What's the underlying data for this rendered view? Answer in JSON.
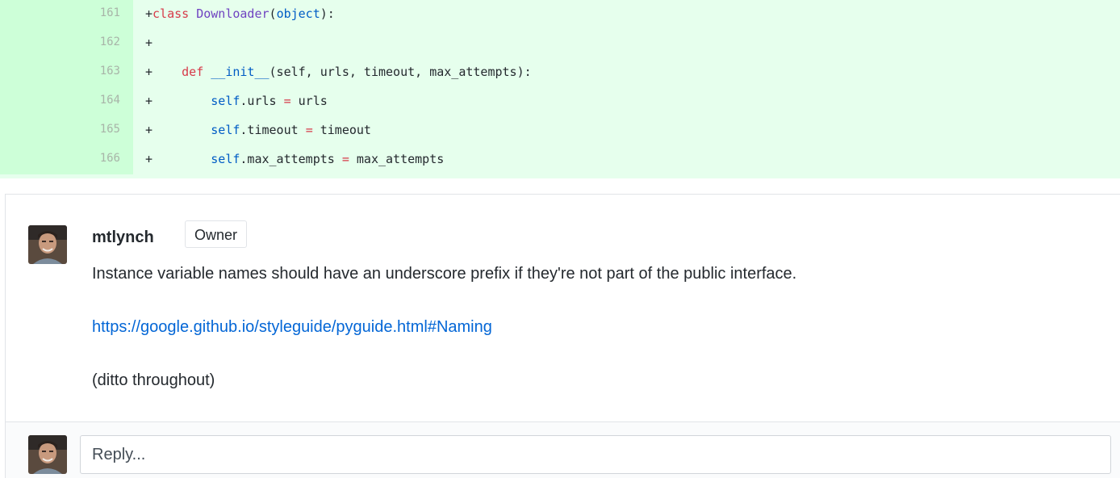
{
  "diff": {
    "lines": [
      {
        "number": "161",
        "tokens": [
          {
            "text": "+",
            "type": "plain"
          },
          {
            "text": "class",
            "type": "kw"
          },
          {
            "text": " ",
            "type": "plain"
          },
          {
            "text": "Downloader",
            "type": "entity"
          },
          {
            "text": "(",
            "type": "plain"
          },
          {
            "text": "object",
            "type": "builtin"
          },
          {
            "text": "):",
            "type": "plain"
          }
        ]
      },
      {
        "number": "162",
        "tokens": [
          {
            "text": "+",
            "type": "plain"
          }
        ]
      },
      {
        "number": "163",
        "tokens": [
          {
            "text": "+    ",
            "type": "plain"
          },
          {
            "text": "def",
            "type": "kw"
          },
          {
            "text": " ",
            "type": "plain"
          },
          {
            "text": "__init__",
            "type": "builtin"
          },
          {
            "text": "(self, urls, timeout, max_attempts):",
            "type": "plain"
          }
        ]
      },
      {
        "number": "164",
        "tokens": [
          {
            "text": "+        ",
            "type": "plain"
          },
          {
            "text": "self",
            "type": "builtin"
          },
          {
            "text": ".urls ",
            "type": "plain"
          },
          {
            "text": "=",
            "type": "kw"
          },
          {
            "text": " urls",
            "type": "plain"
          }
        ]
      },
      {
        "number": "165",
        "tokens": [
          {
            "text": "+        ",
            "type": "plain"
          },
          {
            "text": "self",
            "type": "builtin"
          },
          {
            "text": ".timeout ",
            "type": "plain"
          },
          {
            "text": "=",
            "type": "kw"
          },
          {
            "text": " timeout",
            "type": "plain"
          }
        ]
      },
      {
        "number": "166",
        "tokens": [
          {
            "text": "+        ",
            "type": "plain"
          },
          {
            "text": "self",
            "type": "builtin"
          },
          {
            "text": ".max_attempts ",
            "type": "plain"
          },
          {
            "text": "=",
            "type": "kw"
          },
          {
            "text": " max_attempts",
            "type": "plain"
          }
        ]
      }
    ]
  },
  "comment": {
    "author": "mtlynch",
    "badge": "Owner",
    "paragraphs": {
      "first": "Instance variable names should have an underscore prefix if they're not part of the public interface.",
      "link": "https://google.github.io/styleguide/pyguide.html#Naming",
      "last": "(ditto throughout)"
    },
    "avatar_icon": "user-avatar-photo"
  },
  "reply": {
    "placeholder": "Reply..."
  },
  "colors": {
    "diff_added_bg": "#e6ffed",
    "diff_gutter_bg": "#cdffd8",
    "keyword": "#d73a49",
    "entity": "#6f42c1",
    "builtin": "#005cc5",
    "link": "#0366d6"
  }
}
